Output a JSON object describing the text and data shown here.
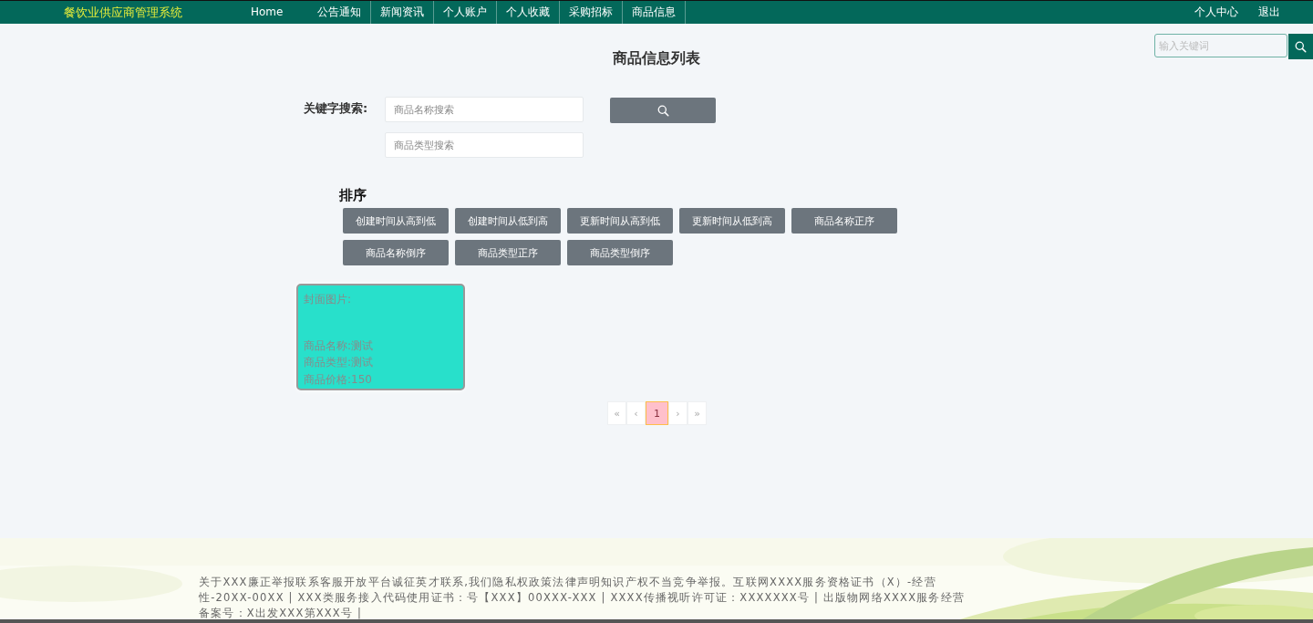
{
  "nav": {
    "brand": "餐饮业供应商管理系统",
    "items": [
      "Home",
      "公告通知",
      "新闻资讯",
      "个人账户",
      "个人收藏",
      "采购招标",
      "商品信息"
    ],
    "right": [
      "个人中心",
      "退出"
    ]
  },
  "top_search": {
    "placeholder": "输入关键词"
  },
  "title": "商品信息列表",
  "filter": {
    "label": "关键字搜索:",
    "fields": [
      {
        "placeholder": "商品名称搜索"
      },
      {
        "placeholder": "商品类型搜索"
      }
    ]
  },
  "sort": {
    "heading": "排序",
    "buttons": [
      "创建时间从高到低",
      "创建时间从低到高",
      "更新时间从高到低",
      "更新时间从低到高",
      "商品名称正序",
      "商品名称倒序",
      "商品类型正序",
      "商品类型倒序"
    ]
  },
  "cards": [
    {
      "lines": [
        "封面图片:",
        "商品名称:测试",
        "商品类型:测试",
        "商品价格:150"
      ]
    }
  ],
  "pagination": [
    {
      "label": "«",
      "selected": false
    },
    {
      "label": "‹",
      "selected": false
    },
    {
      "label": "1",
      "selected": true
    },
    {
      "label": "›",
      "selected": false
    },
    {
      "label": "»",
      "selected": false
    }
  ],
  "footer": {
    "text": "关于XXX廉正举报联系客服开放平台诚征英才联系,我们隐私权政策法律声明知识产权不当竞争举报。互联网XXXX服务资格证书（X）-经营性-20XX-00XX | XXX类服务接入代码使用证书：号【XXX】00XXX-XXX | XXXX传播视听许可证：XXXXXXX号 | 出版物网络XXXX服务经营备案号：X出发XXX第XXX号 |"
  }
}
